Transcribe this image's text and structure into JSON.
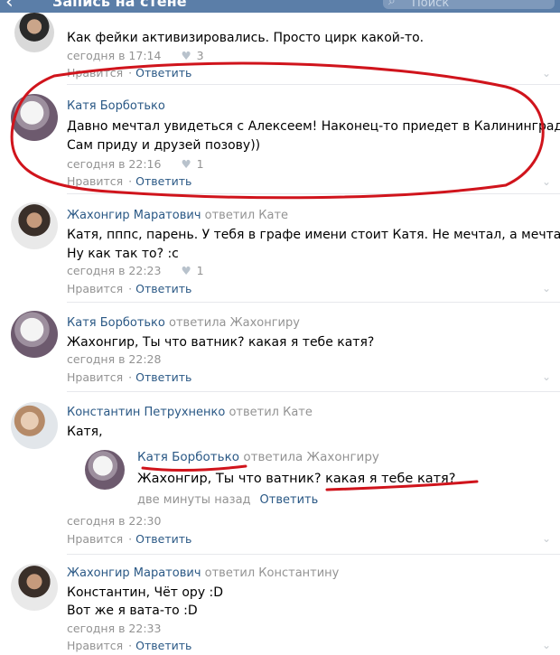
{
  "header": {
    "back_glyph": "‹",
    "title": "Запись на стене",
    "search_placeholder": "Поиск"
  },
  "comments": [
    {
      "author": "",
      "reply_to": "",
      "lines": [
        "Как фейки активизировались. Просто цирк какой-то."
      ],
      "time": "сегодня в 17:14",
      "likes": "3",
      "like_label": "Нравится",
      "reply_label": "Ответить"
    },
    {
      "author": "Катя Борботько",
      "reply_to": "",
      "lines": [
        "Давно мечтал увидеться с Алексеем! Наконец-то приедет в Калининград.",
        "Сам приду и друзей позову))"
      ],
      "time": "сегодня в 22:16",
      "likes": "1",
      "like_label": "Нравится",
      "reply_label": "Ответить"
    },
    {
      "author": "Жахонгир Маратович",
      "reply_to": "ответил Кате",
      "lines": [
        "Катя, пппс, парень. У тебя в графе имени стоит Катя. Не мечтал, а мечтала.",
        "Ну как так то? :с"
      ],
      "time": "сегодня в 22:23",
      "likes": "1",
      "like_label": "Нравится",
      "reply_label": "Ответить"
    },
    {
      "author": "Катя Борботько",
      "reply_to": "ответила Жахонгиру",
      "lines": [
        "Жахонгир, Ты что ватник? какая я тебе катя?"
      ],
      "time": "сегодня в 22:28",
      "likes": "",
      "like_label": "Нравится",
      "reply_label": "Ответить"
    },
    {
      "author": "Константин Петрухненко",
      "reply_to": "ответил Кате",
      "lines": [
        "Катя,"
      ],
      "time": "сегодня в 22:30",
      "likes": "",
      "like_label": "Нравится",
      "reply_label": "Ответить",
      "quote": {
        "author": "Катя Борботько",
        "reply_to": "ответила Жахонгиру",
        "text": "Жахонгир, Ты что ватник? какая я тебе катя?",
        "time": "две минуты назад",
        "reply_label": "Ответить"
      }
    },
    {
      "author": "Жахонгир Маратович",
      "reply_to": "ответил Константину",
      "lines": [
        "Константин, Чёт ору :D",
        "Вот же я вата-то :D"
      ],
      "time": "сегодня в 22:33",
      "likes": "",
      "like_label": "Нравится",
      "reply_label": "Ответить"
    }
  ],
  "annotation_color": "#d0141c",
  "icons": {
    "heart": "heart-icon",
    "chevron": "chevron-down-icon",
    "search": "search-icon",
    "back": "back-arrow-icon"
  }
}
